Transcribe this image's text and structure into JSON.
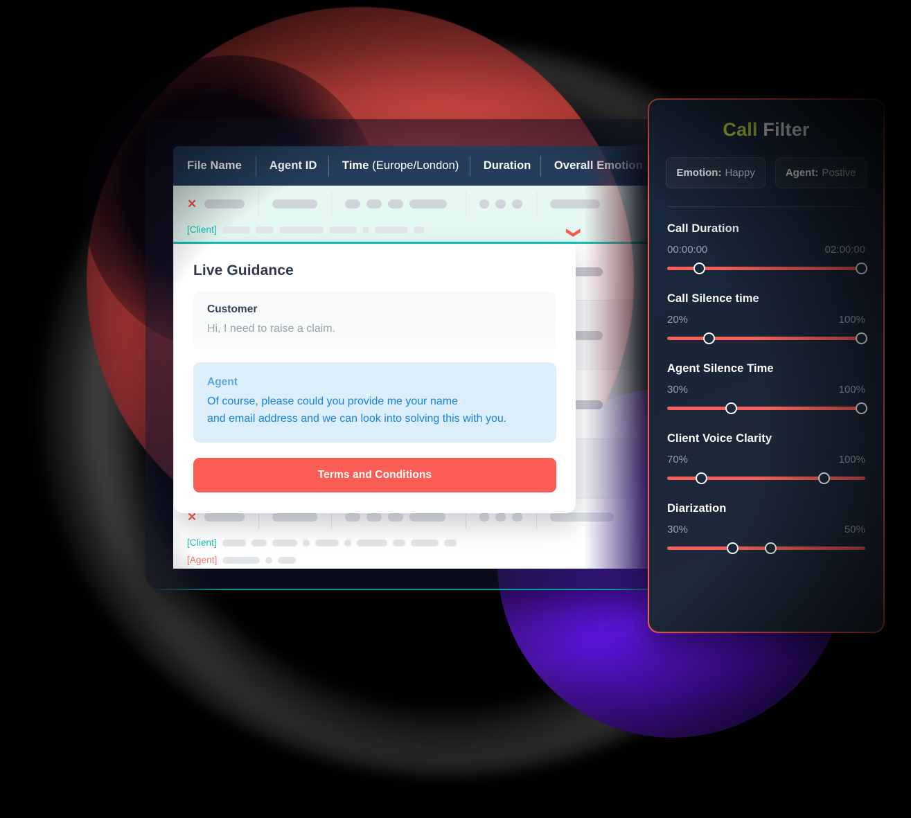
{
  "table": {
    "columns": [
      {
        "label": "File Name",
        "sub": ""
      },
      {
        "label": "Agent ID",
        "sub": ""
      },
      {
        "label": "Time",
        "sub": " (Europe/London)"
      },
      {
        "label": "Duration",
        "sub": ""
      },
      {
        "label": "Overall Emotion",
        "sub": ""
      }
    ],
    "speaker_client": "[Client]",
    "speaker_agent": "[Agent]",
    "remove_icon": "✕",
    "expand_icon": "❯"
  },
  "guidance": {
    "title": "Live Guidance",
    "customer": {
      "name": "Customer",
      "text": "Hi, I need to raise a claim."
    },
    "agent": {
      "name": "Agent",
      "line1": "Of course, please could you provide me your name",
      "line2": "and email address and we can look into solving this with you."
    },
    "cta_label": "Terms and Conditions"
  },
  "filter": {
    "title_accent": "Call",
    "title_rest": " Filter",
    "chips": [
      {
        "label": "Emotion:",
        "value": "Happy"
      },
      {
        "label": "Agent:",
        "value": "Postive"
      }
    ],
    "sliders": [
      {
        "label": "Call Duration",
        "min_text": "00:00:00",
        "max_text": "02:00:00",
        "knob_left_pct": 16,
        "knob_right_pct": 98
      },
      {
        "label": "Call Silence time",
        "min_text": "20%",
        "max_text": "100%",
        "knob_left_pct": 21,
        "knob_right_pct": 98
      },
      {
        "label": "Agent Silence Time",
        "min_text": "30%",
        "max_text": "100%",
        "knob_left_pct": 32,
        "knob_right_pct": 98
      },
      {
        "label": "Client Voice Clarity",
        "min_text": "70%",
        "max_text": "100%",
        "knob_left_pct": 17,
        "knob_right_pct": 79
      },
      {
        "label": "Diarization",
        "min_text": "30%",
        "max_text": "50%",
        "knob_left_pct": 33,
        "knob_right_pct": 52
      }
    ]
  },
  "colors": {
    "accent_red": "#fb5c54",
    "accent_teal": "#13c4b0",
    "accent_lime": "#ccf045",
    "header_navy": "#253d5b",
    "panel_navy": "#1b2a3f",
    "agent_blue": "#1583e0"
  }
}
